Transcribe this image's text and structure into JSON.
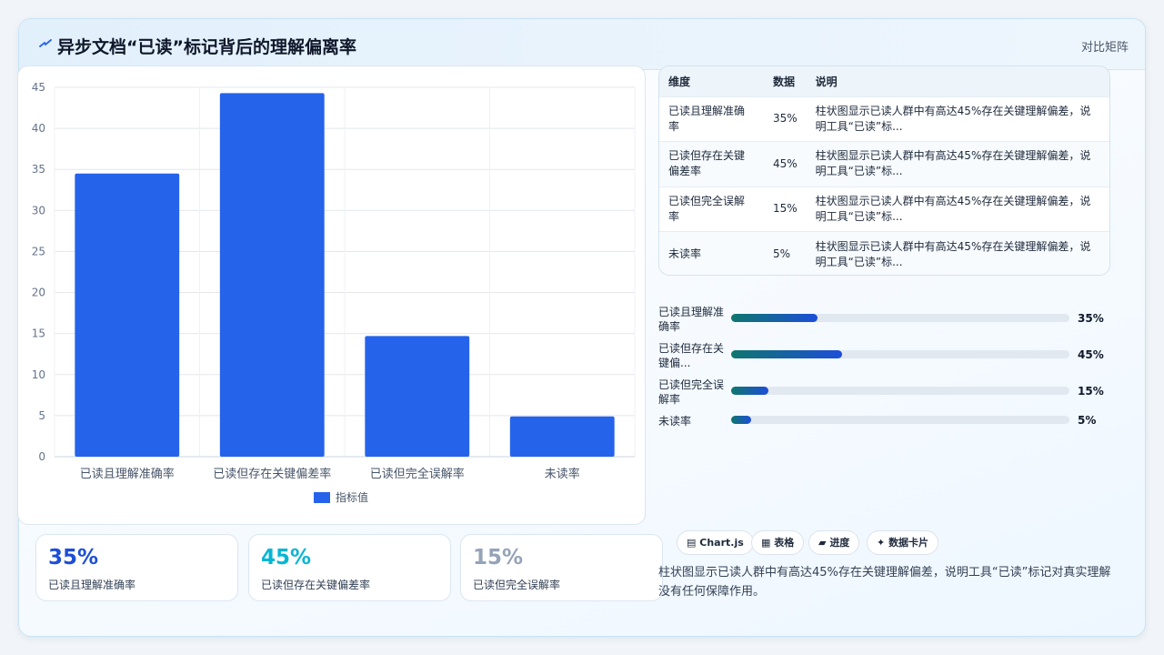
{
  "header": {
    "title": "异步文档“已读”标记背后的理解偏离率",
    "view_label": "对比矩阵"
  },
  "colors": {
    "bar": "#2563eb",
    "kpi_1": "#1d4ed8",
    "kpi_2": "#06b6d4",
    "kpi_3": "#94a3b8"
  },
  "chart_data": {
    "type": "bar",
    "categories": [
      "已读且理解准确率",
      "已读但存在关键偏差率",
      "已读但完全误解率",
      "未读率"
    ],
    "series": [
      {
        "name": "指标值",
        "values": [
          34.5,
          44.3,
          14.7,
          4.9
        ]
      }
    ],
    "yticks": [
      "0",
      "5",
      "10",
      "15",
      "20",
      "25",
      "30",
      "35",
      "40",
      "45"
    ],
    "ylim": [
      0,
      45
    ],
    "xlabel": "",
    "ylabel": "",
    "grid": true,
    "legend": "bottom"
  },
  "kpis": [
    {
      "value": "35%",
      "label": "已读且理解准确率"
    },
    {
      "value": "45%",
      "label": "已读但存在关键偏差率"
    },
    {
      "value": "15%",
      "label": "已读但完全误解率"
    }
  ],
  "table": {
    "headers": [
      "维度",
      "数据",
      "说明"
    ],
    "rows": [
      {
        "dim": "已读且理解准确率",
        "val": "35%",
        "note": "柱状图显示已读人群中有高达45%存在关键理解偏差，说明工具“已读”标..."
      },
      {
        "dim": "已读但存在关键偏差率",
        "val": "45%",
        "note": "柱状图显示已读人群中有高达45%存在关键理解偏差，说明工具“已读”标..."
      },
      {
        "dim": "已读但完全误解率",
        "val": "15%",
        "note": "柱状图显示已读人群中有高达45%存在关键理解偏差，说明工具“已读”标..."
      },
      {
        "dim": "未读率",
        "val": "5%",
        "note": "柱状图显示已读人群中有高达45%存在关键理解偏差，说明工具“已读”标..."
      }
    ]
  },
  "progress": [
    {
      "label": "已读且理解准确率",
      "value": "35%",
      "fraction": 0.255
    },
    {
      "label": "已读但存在关键偏...",
      "value": "45%",
      "fraction": 0.327
    },
    {
      "label": "已读但完全误解率",
      "value": "15%",
      "fraction": 0.109
    },
    {
      "label": "未读率",
      "value": "5%",
      "fraction": 0.06
    }
  ],
  "tags": [
    {
      "icon": "▤",
      "label": "Chart.js"
    },
    {
      "icon": "▦",
      "label": "表格"
    },
    {
      "icon": "▰",
      "label": "进度"
    },
    {
      "icon": "✦",
      "label": "数据卡片"
    }
  ],
  "summary": "柱状图显示已读人群中有高达45%存在关键理解偏差，说明工具“已读”标记对真实理解没有任何保障作用。"
}
